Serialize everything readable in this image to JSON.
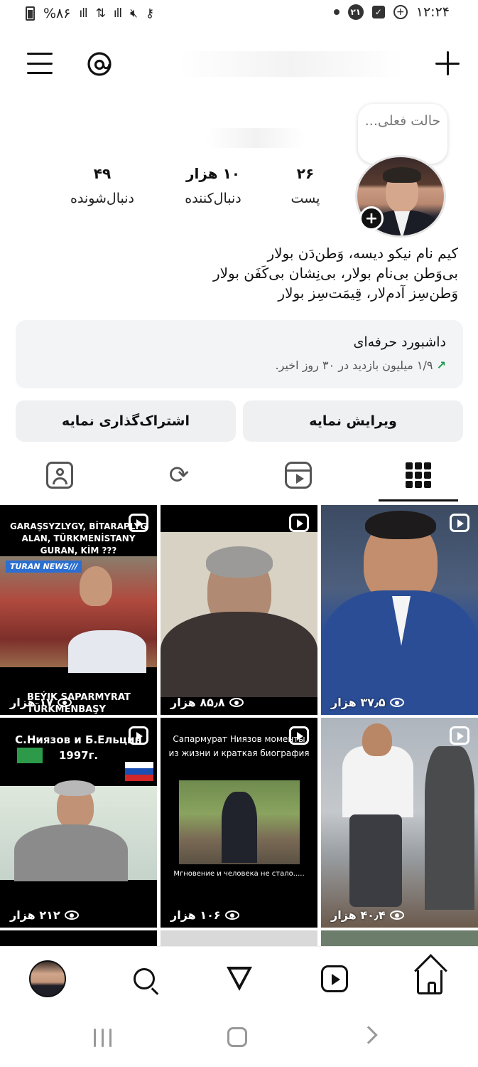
{
  "status_bar": {
    "battery": "%۸۶",
    "time": "۱۲:۲۴",
    "notification_count": "۲۱"
  },
  "profile": {
    "note_text": "حالت فعلی...",
    "stats": [
      {
        "value": "۲۶",
        "label": "پست"
      },
      {
        "value": "۱۰ هزار",
        "label": "دنبال‌کننده"
      },
      {
        "value": "۴۹",
        "label": "دنبال‌شونده"
      }
    ],
    "bio_lines": [
      "کیم نام نیکو دیسه، وَطن‌دَن بولار",
      "بی‌وَطن بی‌نام بولار، بی‌نِشان بی‌کَفَن بولار",
      "وَطن‌سِز آدم‌لار، قِیمَت‌سِز بولار"
    ],
    "dashboard": {
      "title": "داشبورد حرفه‌ای",
      "subtitle": "۱/۹ میلیون بازدید در ۳۰ روز اخیر.",
      "arrow": "↗"
    },
    "buttons": {
      "edit": "ویرایش نمایه",
      "share": "اشتراک‌گذاری نمایه"
    }
  },
  "tabs": [
    "grid",
    "reels",
    "reposts",
    "tagged"
  ],
  "posts": [
    {
      "views": "۳۷٫۵ هزار",
      "caption": ""
    },
    {
      "views": "۸۵٫۸ هزار",
      "caption": ""
    },
    {
      "views": "۱۷ هزار",
      "caption": "GARAŞSYZLYGY, BİTARAPLYG ALAN, TÜRKMENİSTANY GURAN, KİM ???",
      "sub_caption": "TURAN NEWS///",
      "bottom_caption": "BEÝIK SAPARMYRAT TÜRKMENBAŞY"
    },
    {
      "views": "۴۰٫۴ هزار",
      "caption": ""
    },
    {
      "views": "۱۰۶ هزار",
      "caption": "Сапармурат Ниязов моменты из жизни и краткая биография",
      "bottom_caption": "Мгновение и человека не стало....."
    },
    {
      "views": "۲۱۲ هزار",
      "caption": "С.Ниязов и Б.Ельцин 1997г."
    }
  ],
  "colors": {
    "accent_green": "#1c9a4e",
    "button_bg": "#eef0f2",
    "dashboard_bg": "#f2f4f6"
  }
}
